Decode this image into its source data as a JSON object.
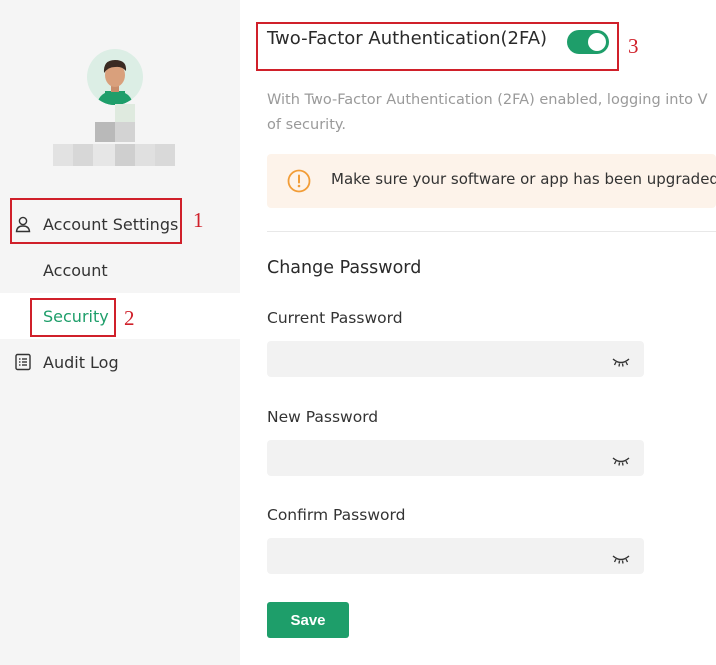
{
  "sidebar": {
    "group_label": "Account Settings",
    "items": [
      {
        "label": "Account"
      },
      {
        "label": "Security"
      }
    ],
    "audit_label": "Audit Log"
  },
  "security": {
    "tfa_title": "Two-Factor Authentication(2FA)",
    "tfa_enabled": true,
    "description": "With Two-Factor Authentication (2FA) enabled, logging into V",
    "description_line2": "of security.",
    "warning": "Make sure your software or app has been upgraded t",
    "change_password_title": "Change Password",
    "fields": [
      {
        "label": "Current Password",
        "value": ""
      },
      {
        "label": "New Password",
        "value": ""
      },
      {
        "label": "Confirm Password",
        "value": ""
      }
    ],
    "save_label": "Save"
  },
  "annotations": [
    "1",
    "2",
    "3"
  ],
  "colors": {
    "accent": "#1e9e6a",
    "annotation": "#d0202a",
    "warning_bg": "#fdf3ea",
    "warning_icon": "#f29d38"
  }
}
